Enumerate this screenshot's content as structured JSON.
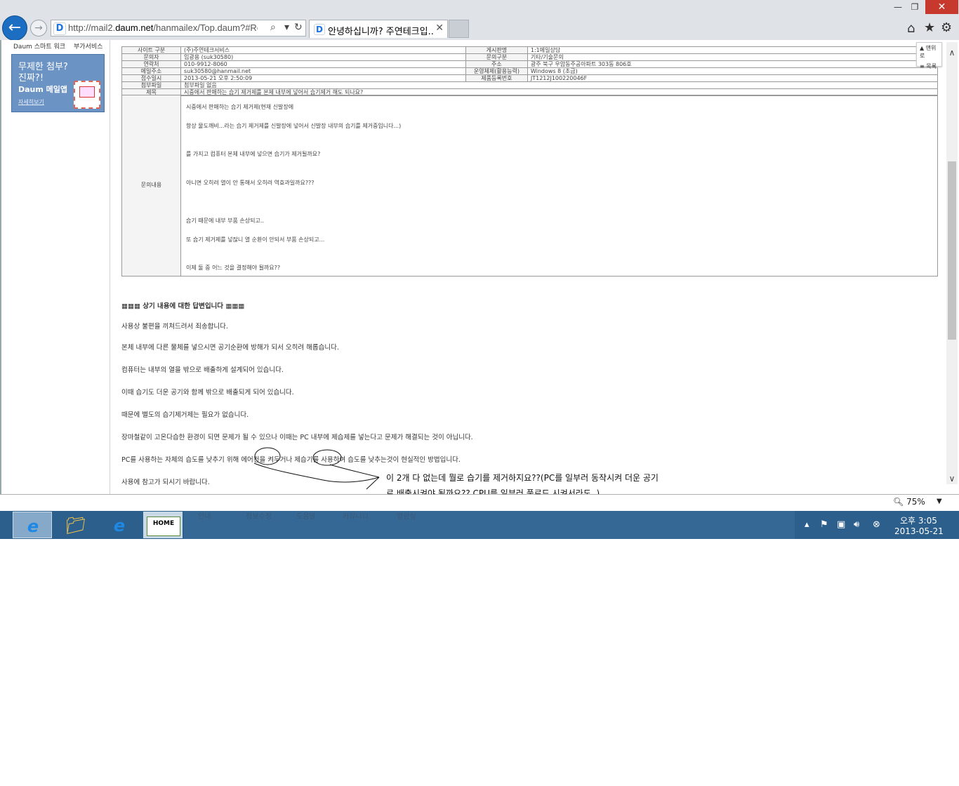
{
  "browser": {
    "url_prefix": "http://mail2.",
    "url_domain": "daum.net",
    "url_rest": "/hanmailex/Top.daum?#ReadM",
    "tab_title": "안녕하십니까? 주연테크입...",
    "zoom": "75%"
  },
  "sidebar": {
    "link1": "Daum 스마트 워크",
    "link2": "부가서비스",
    "banner_line1": "무제한 첨부?",
    "banner_line2": "진짜?!",
    "banner_line3": "Daum 메일앱",
    "banner_link": "자세히보기"
  },
  "float_nav": {
    "top": "▲ 맨위로",
    "list": "≡ 목록"
  },
  "info": {
    "rows": [
      {
        "k1": "사이트 구분",
        "v1": "(주)주연테크서비스",
        "k2": "게시판명",
        "v2": "1:1메일상담"
      },
      {
        "k1": "문의자",
        "v1": "임광용 (suk30580)",
        "k2": "문의구분",
        "v2": "기타/기술문의"
      },
      {
        "k1": "연락처",
        "v1": "010-9912-8060",
        "k2": "주소",
        "v2": "광주 북구 우암동주공아파트 303동 806호"
      },
      {
        "k1": "메일주소",
        "v1": "suk30580@hanmail.net",
        "k2": "운영체제(활용능력)",
        "v2": "Windows 8 (초급)"
      },
      {
        "k1": "접수일시",
        "v1": "2013-05-21 오후 2:50:09",
        "k2": "제품등록번호",
        "v2": "JT1212J100220046F"
      }
    ],
    "attach_label": "첨부파일",
    "attach_value": "첨부파일 없음",
    "subject_label": "제목",
    "subject_value": "시중에서 판매하는 습기 제거제를 본체 내부에 넣어서 습기제거 해도 되나요?"
  },
  "question": {
    "label": "문의내용",
    "lines": [
      "시중에서 판매하는 습기 제거제(현재 신발장에",
      "항상 물도깨비...라는 습기 제거제를 신발장에 넣어서 신발장 내부의 습기를 제거중입니다...)",
      "를 가지고 컴퓨터 본체 내부에 넣으면 습기가 제거될까요?",
      "아니면 오히려 열이 안 통해서 오히려 역효과일까요???",
      "습기 때문에 내부 부품 손상되고..",
      "또 습기 제거제를 넣잖니 열 순환이 안되서 부품 손상되고...",
      "이제 둘 중 어느 것을 결정해야 될까요??"
    ]
  },
  "answer": {
    "title": "▦▦▦ 상기 내용에 대한 답변입니다 ▦▦▦",
    "lines": [
      "사용상 불편을 끼쳐드려서 죄송합니다.",
      "본체 내부에 다른 물체를 넣으시면 공기순환에 방해가 되서 오히려 해롭습니다.",
      "컴퓨터는 내부의 열을 밖으로 배출하게 설계되어 있습니다.",
      "이때 습기도 더운 공기와 함께 밖으로 배출되게 되어 있습니다.",
      "때문에 별도의 습기제거제는 필요가 없습니다.",
      "장마철같이 고온다습한 환경이 되면 문제가 될 수 있으나 이때는 PC 내부에 제습제를 넣는다고 문제가 해결되는 것이 아닙니다.",
      "PC를 사용하는 자체의 습도를 낮추기 위해 에어컨을 켜두거나 제습기를 사용하여 습도를 낮추는것이 현실적인 방법입니다.",
      "사용에 참고가 되시기 바랍니다."
    ]
  },
  "annotation": {
    "line1": "이 2개 다 없는데 뭘로 습기를 제거하지요??(PC를 일부러 동작시켜 더운 공기",
    "line2": "로 배출시켜야 될까요?? CPU를 일부러 풀로드 시켜서라도..)"
  },
  "taskbar": {
    "home_label": "HOME",
    "ghost_items": [
      "안내",
      "정보수정",
      "도움말",
      "커뮤니티",
      "열람실"
    ],
    "clock_time": "오후 3:05",
    "clock_date": "2013-05-21"
  }
}
